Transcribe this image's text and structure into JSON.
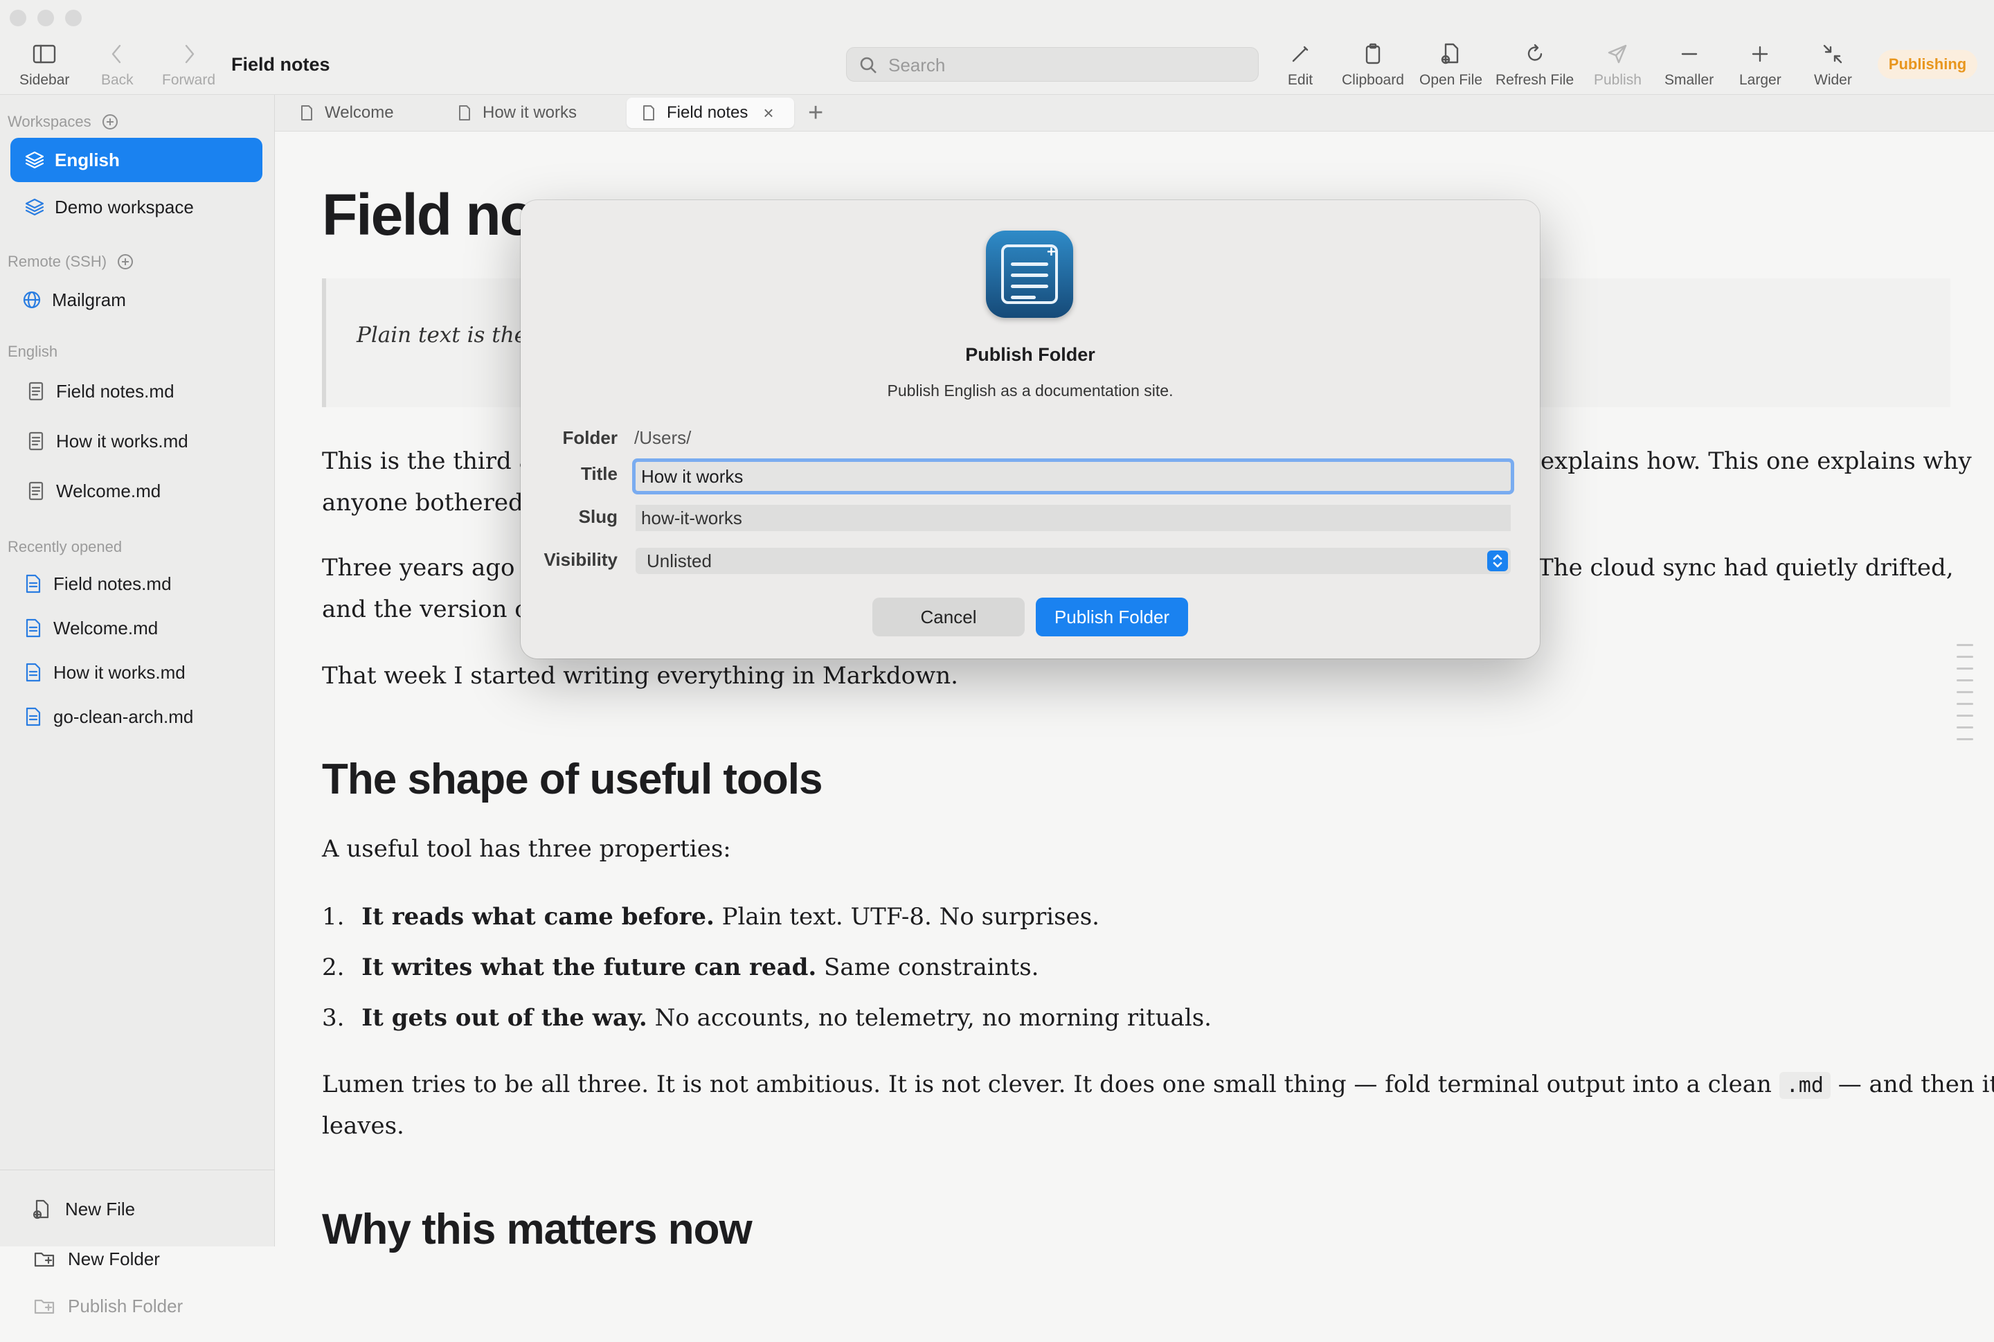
{
  "window": {
    "title": "Field notes"
  },
  "toolbar": {
    "sidebar": "Sidebar",
    "back": "Back",
    "forward": "Forward",
    "edit": "Edit",
    "clipboard": "Clipboard",
    "open_file": "Open File",
    "refresh_file": "Refresh File",
    "publish": "Publish",
    "smaller": "Smaller",
    "larger": "Larger",
    "wider": "Wider",
    "status_badge": "Publishing",
    "search_placeholder": "Search"
  },
  "sidebar": {
    "workspaces_heading": "Workspaces",
    "workspaces": [
      {
        "label": "English",
        "active": true
      },
      {
        "label": "Demo workspace",
        "active": false
      }
    ],
    "remote_heading": "Remote (SSH)",
    "remotes": [
      {
        "label": "Mailgram"
      }
    ],
    "files_heading": "English",
    "files": [
      {
        "label": "Field notes.md"
      },
      {
        "label": "How it works.md"
      },
      {
        "label": "Welcome.md"
      }
    ],
    "recent_heading": "Recently opened",
    "recent": [
      {
        "label": "Field notes.md"
      },
      {
        "label": "Welcome.md"
      },
      {
        "label": "How it works.md"
      },
      {
        "label": "go-clean-arch.md"
      }
    ],
    "actions": {
      "new_file": "New File",
      "new_folder": "New Folder",
      "publish_folder": "Publish Folder"
    }
  },
  "tabs": [
    {
      "label": "Welcome"
    },
    {
      "label": "How it works"
    },
    {
      "label": "Field notes",
      "active": true
    }
  ],
  "document": {
    "title": "Field no",
    "quote": "Plain text is the",
    "para1_line1_left": "This is the third ar",
    "para1_line1_right": "explains how. This one explains why",
    "para1_line2": "anyone bothered.",
    "para2_line1_left": "Three years ago I",
    "para2_line1_right": "The cloud sync had quietly drifted,",
    "para2_line2": "and the version or",
    "para3": "That week I started writing everything in Markdown.",
    "h2_tools": "The shape of useful tools",
    "tools_intro": "A useful tool has three properties:",
    "list": [
      {
        "num": "1.",
        "bold": "It reads what came before.",
        "rest": " Plain text. UTF-8. No surprises."
      },
      {
        "num": "2.",
        "bold": "It writes what the future can read.",
        "rest": " Same constraints."
      },
      {
        "num": "3.",
        "bold": "It gets out of the way.",
        "rest": " No accounts, no telemetry, no morning rituals."
      }
    ],
    "closing_line1_a": "Lumen tries to be all three. It is not ambitious. It is not clever. It does one small thing — fold terminal output into a clean",
    "closing_code": ".md",
    "closing_line1_b": "— and then it",
    "closing_line2": "leaves.",
    "h2_why": "Why this matters now"
  },
  "dialog": {
    "title": "Publish Folder",
    "subtitle": "Publish English as a documentation site.",
    "folder_label": "Folder",
    "folder_value": "/Users/",
    "title_label": "Title",
    "title_value": "How it works",
    "slug_label": "Slug",
    "slug_value": "how-it-works",
    "visibility_label": "Visibility",
    "visibility_value": "Unlisted",
    "cancel": "Cancel",
    "confirm": "Publish Folder"
  },
  "colors": {
    "accent": "#1a82f0",
    "badge_text": "#e8961e",
    "badge_bg": "#fbeede"
  }
}
